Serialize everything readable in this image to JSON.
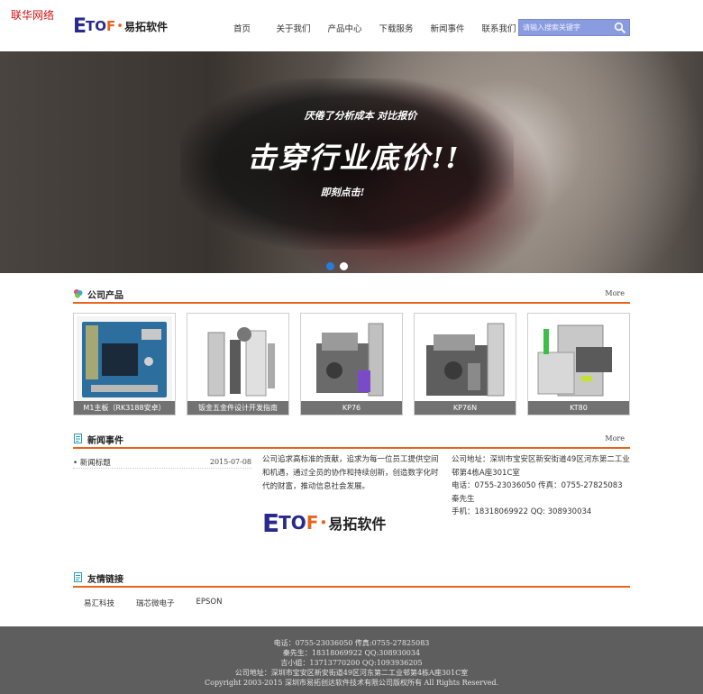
{
  "watermark": "联华网络",
  "logo": {
    "e": "E",
    "to": "TO",
    "f": "F",
    "dot": "•",
    "cn": "易拓软件"
  },
  "nav": [
    {
      "label": "首页"
    },
    {
      "label": "关于我们"
    },
    {
      "label": "产品中心"
    },
    {
      "label": "下载服务"
    },
    {
      "label": "新闻事件"
    },
    {
      "label": "联系我们"
    }
  ],
  "search": {
    "placeholder": "请输入搜索关键字",
    "icon": "search-icon"
  },
  "banner": {
    "line1": "厌倦了分析成本  对比报价",
    "line2": "击穿行业底价!!",
    "line3": "即刻点击!",
    "slides": 2,
    "active_slide": 1
  },
  "products_section": {
    "title": "公司产品",
    "more": "More",
    "icon": "product-icon"
  },
  "products": [
    {
      "caption": "M1主板（RK3188安卓）"
    },
    {
      "caption": "钣金五金件设计开发指南"
    },
    {
      "caption": "KP76"
    },
    {
      "caption": "KP76N"
    },
    {
      "caption": "KT80"
    }
  ],
  "news_section": {
    "title": "新闻事件",
    "more": "More",
    "icon": "news-icon"
  },
  "news": [
    {
      "title": "• 新闻标题",
      "date": "2015-07-08"
    }
  ],
  "intro": "公司追求高标准的贡献，追求为每一位员工提供空间和机遇，通过全员的协作和持续创新，创造数字化时代的财富，推动信息社会发展。",
  "contact": {
    "address": "公司地址：深圳市宝安区新安街道49区河东第二工业邨第4栋A座301C室",
    "phone": "电话：0755-23036050  传真：0755-27825083",
    "person": "秦先生",
    "mobile": "手机：18318069922      QQ:  308930034"
  },
  "links_section": {
    "title": "友情链接",
    "icon": "link-icon"
  },
  "links": [
    {
      "label": "易汇科技"
    },
    {
      "label": "瑞芯微电子"
    },
    {
      "label": "EPSON"
    }
  ],
  "footer": {
    "line1": "电话：0755-23036050 传真:0755-27825083",
    "line2": "秦先生：18318069922 QQ:308930034",
    "line3": "吉小姐：13713770200 QQ:1093936205",
    "line4": "公司地址：深圳市宝安区新安街道49区河东第二工业邨第4栋A座301C室",
    "line5": "Copyright 2003-2015 深圳市易拓创达软件技术有限公司版权所有 All Rights Reserved."
  },
  "colors": {
    "accent": "#e8641e",
    "brand_blue": "#2a2a8c",
    "footer_bg": "#5e5e5e",
    "search_bg": "#8a9ce0",
    "dot_active": "#2a7ad8"
  }
}
